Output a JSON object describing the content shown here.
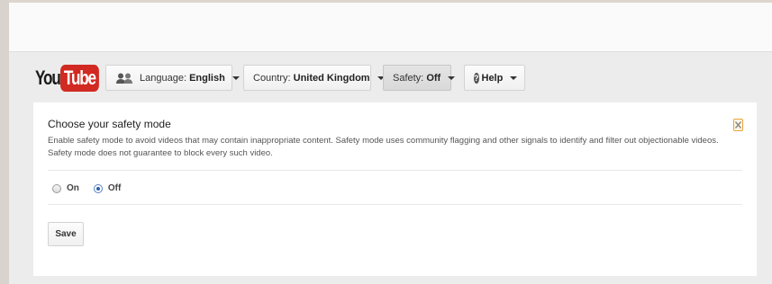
{
  "header": {
    "logo": {
      "you": "You",
      "tube": "Tube"
    },
    "language": {
      "label": "Language:",
      "value": "English"
    },
    "country": {
      "label": "Country:",
      "value": "United Kingdom"
    },
    "safety": {
      "label": "Safety:",
      "value": "Off"
    },
    "help": {
      "label": "Help"
    }
  },
  "panel": {
    "title": "Choose your safety mode",
    "description": "Enable safety mode to avoid videos that may contain inappropriate content. Safety mode uses community flagging and other signals to identify and filter out objectionable videos. Safety mode does not guarantee to block every such video.",
    "options": [
      {
        "label": "On",
        "checked": false
      },
      {
        "label": "Off",
        "checked": true
      }
    ],
    "save_label": "Save"
  },
  "colors": {
    "logo_red": "#d12a22",
    "radio_accent": "#2a5db0",
    "close_icon": "#e8a33a"
  }
}
